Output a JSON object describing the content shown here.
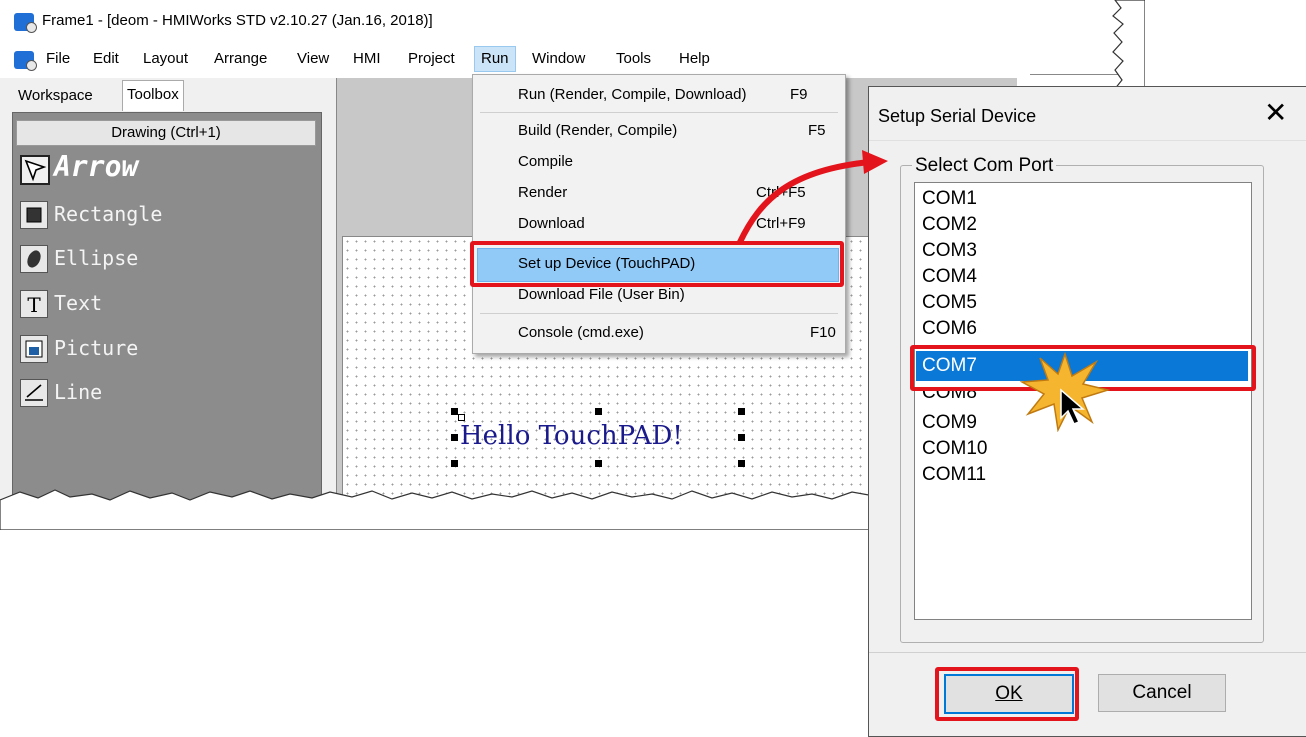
{
  "window": {
    "title": "Frame1 - [deom - HMIWorks STD v2.10.27 (Jan.16, 2018)]"
  },
  "menubar": {
    "items": [
      "File",
      "Edit",
      "Layout",
      "Arrange",
      "View",
      "HMI",
      "Project",
      "Run",
      "Window",
      "Tools",
      "Help"
    ],
    "active": "Run"
  },
  "left_panel": {
    "tabs": [
      "Workspace",
      "Toolbox"
    ],
    "selected_tab": "Toolbox",
    "toolbox_header": "Drawing (Ctrl+1)",
    "tools": [
      "Arrow",
      "Rectangle",
      "Ellipse",
      "Text",
      "Picture",
      "Line"
    ],
    "selected_tool": "Arrow"
  },
  "canvas": {
    "text": "Hello TouchPAD!"
  },
  "run_menu": {
    "items": [
      {
        "label": "Run (Render, Compile, Download)",
        "shortcut": "F9"
      },
      {
        "label": "Build (Render, Compile)",
        "shortcut": "F5"
      },
      {
        "label": "Compile",
        "shortcut": ""
      },
      {
        "label": "Render",
        "shortcut": "Ctrl+F5"
      },
      {
        "label": "Download",
        "shortcut": "Ctrl+F9"
      },
      {
        "label": "Set up Device (TouchPAD)",
        "shortcut": ""
      },
      {
        "label": "Download File (User Bin)",
        "shortcut": ""
      },
      {
        "label": "Console (cmd.exe)",
        "shortcut": "F10"
      }
    ],
    "highlighted": "Set up Device (TouchPAD)"
  },
  "dialog": {
    "title": "Setup Serial Device",
    "close_glyph": "✕",
    "group_label": "Select Com Port",
    "ports": [
      "COM1",
      "COM2",
      "COM3",
      "COM4",
      "COM5",
      "COM6",
      "COM7",
      "COM8",
      "COM9",
      "COM10",
      "COM11"
    ],
    "selected_port": "COM7",
    "ok_label": "OK",
    "cancel_label": "Cancel"
  },
  "colors": {
    "highlight_box": "#e4141c",
    "menu_highlight": "#91c9f7",
    "list_selection": "#0a78d7",
    "toolbox_bg": "#8c8c8c",
    "click_burst": "#f5b52e"
  },
  "icons": [
    "app-icon",
    "arrow-tool-icon",
    "rectangle-tool-icon",
    "ellipse-tool-icon",
    "text-tool-icon",
    "picture-tool-icon",
    "line-tool-icon",
    "close-icon",
    "mouse-cursor-icon",
    "click-burst-icon",
    "callout-arrow"
  ]
}
